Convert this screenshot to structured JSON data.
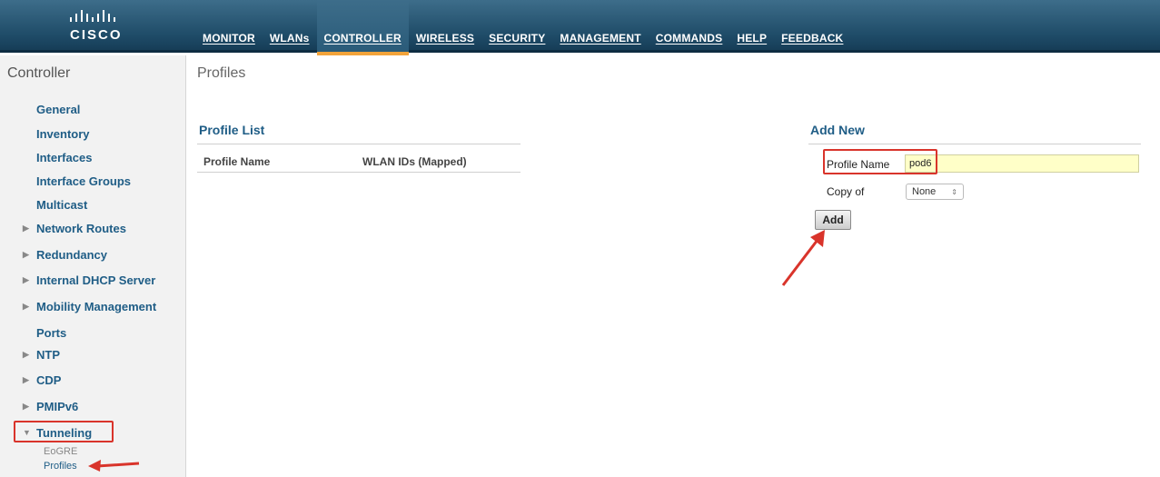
{
  "brand": {
    "logo_text": "CISCO"
  },
  "nav": [
    {
      "label": "MONITOR"
    },
    {
      "label": "WLANs"
    },
    {
      "label": "CONTROLLER"
    },
    {
      "label": "WIRELESS"
    },
    {
      "label": "SECURITY"
    },
    {
      "label": "MANAGEMENT"
    },
    {
      "label": "COMMANDS"
    },
    {
      "label": "HELP"
    },
    {
      "label": "FEEDBACK"
    }
  ],
  "active_nav": "CONTROLLER",
  "sidebar": {
    "title": "Controller",
    "items": [
      {
        "label": "General"
      },
      {
        "label": "Inventory"
      },
      {
        "label": "Interfaces"
      },
      {
        "label": "Interface Groups"
      },
      {
        "label": "Multicast"
      },
      {
        "label": "Network Routes"
      },
      {
        "label": "Redundancy"
      },
      {
        "label": "Internal DHCP Server"
      },
      {
        "label": "Mobility Management"
      },
      {
        "label": "Ports"
      },
      {
        "label": "NTP"
      },
      {
        "label": "CDP"
      },
      {
        "label": "PMIPv6"
      },
      {
        "label": "Tunneling"
      }
    ],
    "subitems": [
      {
        "label": "EoGRE"
      },
      {
        "label": "Profiles"
      }
    ]
  },
  "main": {
    "page_title": "Profiles",
    "profile_list": {
      "title": "Profile List",
      "columns": [
        "Profile Name",
        "WLAN IDs (Mapped)"
      ]
    },
    "add_new": {
      "title": "Add New",
      "profile_name_label": "Profile Name",
      "profile_name_value": "pod6",
      "copy_of_label": "Copy of",
      "copy_of_value": "None",
      "add_button": "Add"
    }
  },
  "colors": {
    "header": "#1f4c68",
    "accent": "#f2a33a",
    "link": "#1f5d86",
    "highlight": "#d9342b",
    "input_bg": "#ffffc8"
  }
}
